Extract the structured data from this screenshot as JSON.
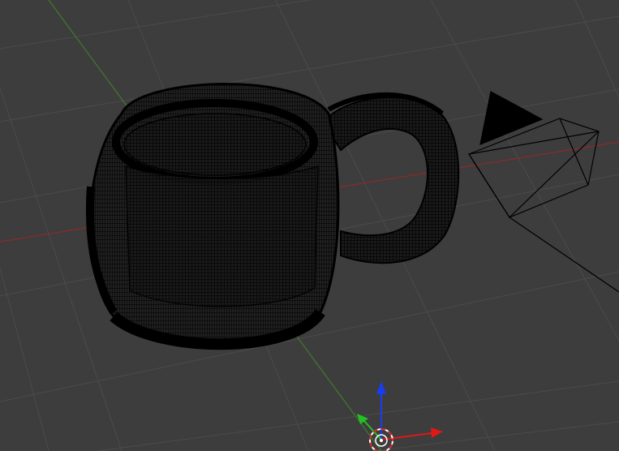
{
  "viewport": {
    "view": "3d-viewport",
    "shading": "wireframe"
  },
  "colors": {
    "background": "#3d3d3d",
    "grid": "#4a4a4a",
    "x_axis": "#8b2a2a",
    "y_axis": "#3f7a2e",
    "wire": "#000000",
    "gizmo_x": "#e01818",
    "gizmo_y": "#22c022",
    "gizmo_z": "#1a3cf0"
  },
  "scene_objects": [
    {
      "name": "mug",
      "type": "mesh"
    },
    {
      "name": "camera",
      "type": "camera"
    }
  ],
  "icons": [
    "mug-mesh-icon",
    "camera-icon",
    "transform-gizmo-icon",
    "3d-cursor-icon"
  ]
}
